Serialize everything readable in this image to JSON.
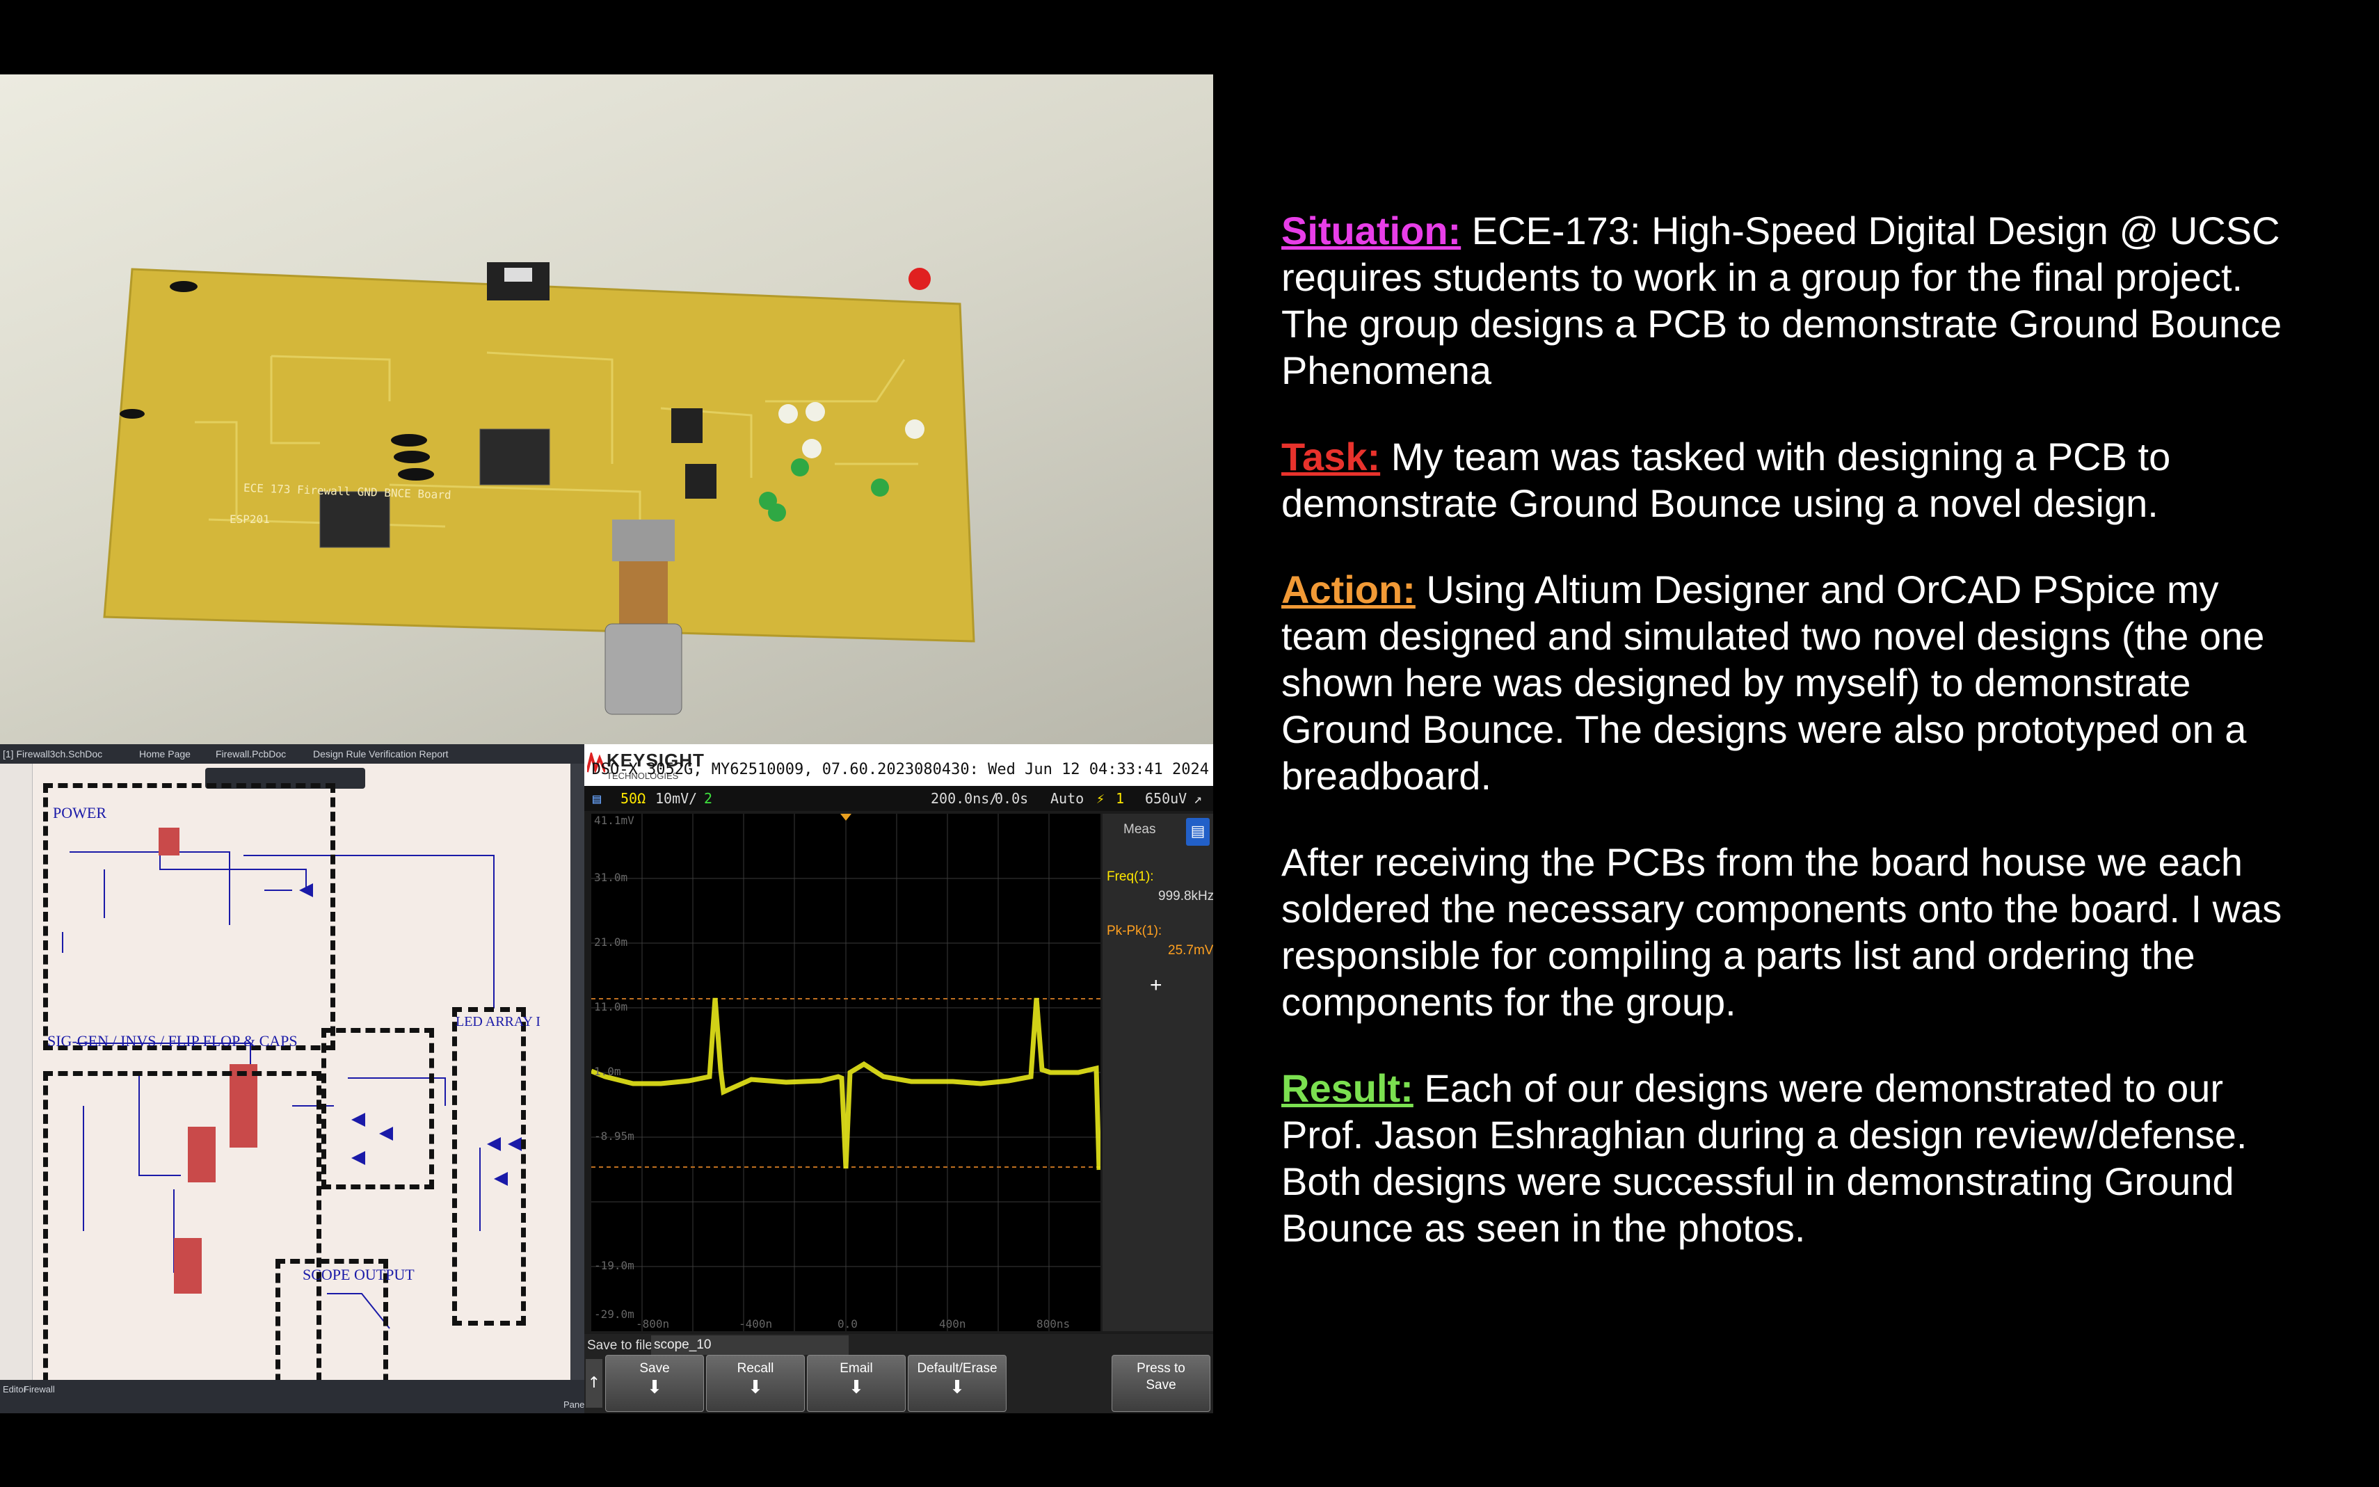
{
  "colors": {
    "situation": "#e83ee8",
    "task": "#e8322c",
    "action": "#f29a36",
    "result": "#7be050",
    "pcb": "#d4b73a",
    "trace": "#e8e81a",
    "schematic_wire": "#1a1aa8"
  },
  "pcb_photo": {
    "silkscreen_line1": "ECE 173 Firewall GND BNCE Board",
    "silkscreen_line2": "ESP201"
  },
  "schematic": {
    "tabs": [
      "[1] Firewall3ch.SchDoc",
      "Home Page",
      "Firewall.PcbDoc",
      "Design Rule Verification Report"
    ],
    "blocks": {
      "power": "POWER",
      "led_array": "LED ARRAY I",
      "sig_gen": "SIG-GEN / INVS / FLIP FLOP & CAPS",
      "scope_output": "SCOPE OUTPUT"
    },
    "footer_left": "Editor",
    "footer_mid": "Firewall",
    "footer_right": "Panels"
  },
  "scope": {
    "brand": "KEYSIGHT",
    "brand_sub": "TECHNOLOGIES",
    "model_line": "DSO-X 3052G, MY62510009, 07.60.2023080430: Wed Jun 12 04:33:41 2024",
    "status": {
      "impedance": "50Ω",
      "scale": "10mV/",
      "channel": "2",
      "timebase": "200.0ns/",
      "delay": "0.0s",
      "mode": "Auto",
      "trig_ch": "1",
      "trig_level": "650uV"
    },
    "y_labels": [
      "41.1mV",
      "31.0m",
      "21.0m",
      "11.0m",
      "1.0m",
      "-8.95m",
      "-19.0m",
      "-29.0m"
    ],
    "x_labels": [
      "-800n",
      "-400n",
      "0.0",
      "400n",
      "800ns"
    ],
    "meas": {
      "title": "Meas",
      "freq_label": "Freq(1):",
      "freq_value": "999.8kHz",
      "pkpk_label": "Pk-Pk(1):",
      "pkpk_value": "25.7mV",
      "add": "+"
    },
    "save_to_file_label": "Save to file =",
    "save_to_file_value": "scope_10",
    "buttons": [
      "Save",
      "Recall",
      "Email",
      "Default/Erase"
    ],
    "press_to_save": [
      "Press to",
      "Save"
    ]
  },
  "star": {
    "situation_head": "Situation:",
    "situation_body": " ECE-173: High-Speed Digital Design @ UCSC requires students to work in a group for the final project. The group designs a PCB to demonstrate Ground Bounce Phenomena",
    "task_head": "Task:",
    "task_body": " My team was tasked with designing a PCB to demonstrate Ground Bounce using a novel design.",
    "action_head": "Action:",
    "action_body": " Using Altium Designer and OrCAD PSpice my team designed and simulated two novel designs (the one shown here was designed by myself) to demonstrate Ground Bounce. The designs were also prototyped on a breadboard.",
    "after": "After receiving the PCBs from the board house we each soldered the necessary components onto the board. I was responsible for compiling a parts list and ordering the components for the group.",
    "result_head": "Result:",
    "result_body": " Each of our designs were demonstrated to our Prof. Jason Eshraghian during a design review/defense. Both designs were successful in demonstrating Ground Bounce as seen in the photos."
  }
}
